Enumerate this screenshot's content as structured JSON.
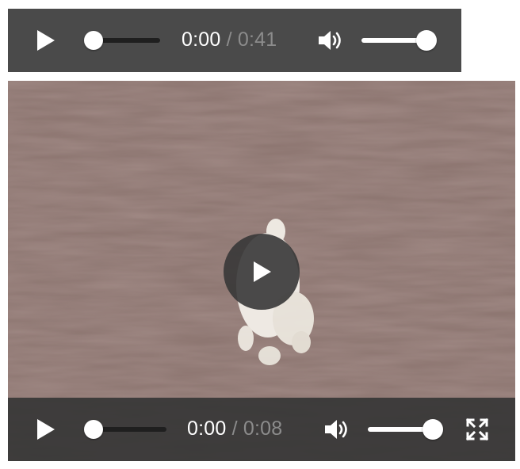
{
  "audio_player": {
    "current_time": "0:00",
    "separator": " / ",
    "duration": "0:41",
    "progress": 0.0,
    "volume": 1.0
  },
  "video_player": {
    "current_time": "0:00",
    "separator": " / ",
    "duration": "0:08",
    "progress": 0.0,
    "volume": 1.0
  },
  "icons": {
    "play": "play-icon",
    "volume": "speaker-volume-icon",
    "fullscreen": "fullscreen-icon",
    "big_play": "play-icon"
  },
  "colors": {
    "control_bar": "#4a4a4a",
    "track_dark": "#1f1f1f",
    "duration_text": "#8c8c8c",
    "control_fg": "#ffffff"
  }
}
